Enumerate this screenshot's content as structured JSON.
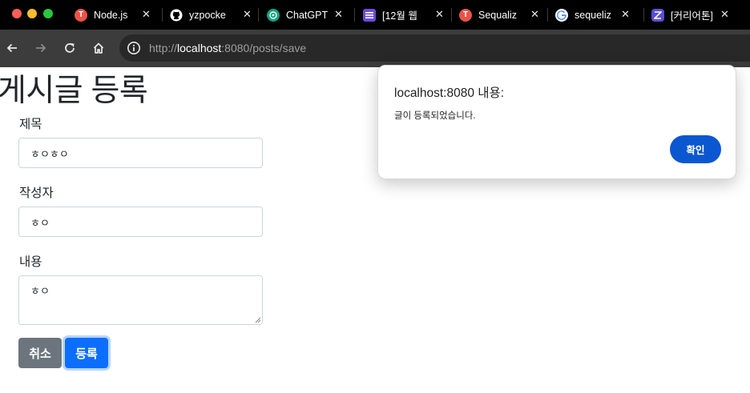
{
  "browser": {
    "tabs": [
      {
        "title": "Node.js",
        "favicon": "red-t-icon",
        "color": "#e8544a"
      },
      {
        "title": "yzpocke",
        "favicon": "github-icon",
        "color": "#ffffff"
      },
      {
        "title": "ChatGPT",
        "favicon": "chatgpt-icon",
        "color": "#10a37f"
      },
      {
        "title": "[12월 웹",
        "favicon": "list-icon",
        "color": "#6b4bd8"
      },
      {
        "title": "Sequaliz",
        "favicon": "red-t-icon",
        "color": "#e8544a"
      },
      {
        "title": "sequeliz",
        "favicon": "google-icon",
        "color": "#4285f4"
      },
      {
        "title": "[커리어톤]",
        "favicon": "zep-icon",
        "color": "#5b4dd6"
      }
    ],
    "favicon_letter": "T",
    "url_scheme": "http://",
    "url_host": "localhost",
    "url_rest": ":8080/posts/save"
  },
  "page": {
    "title": "게시글 등록",
    "fields": [
      {
        "label": "제목",
        "value": "ㅎㅇㅎㅇ"
      },
      {
        "label": "작성자",
        "value": "ㅎㅇ"
      },
      {
        "label": "내용",
        "value": "ㅎㅇ"
      }
    ],
    "cancel_label": "취소",
    "submit_label": "등록"
  },
  "dialog": {
    "title": "localhost:8080 내용:",
    "message": "글이 등록되었습니다.",
    "ok_label": "확인"
  }
}
